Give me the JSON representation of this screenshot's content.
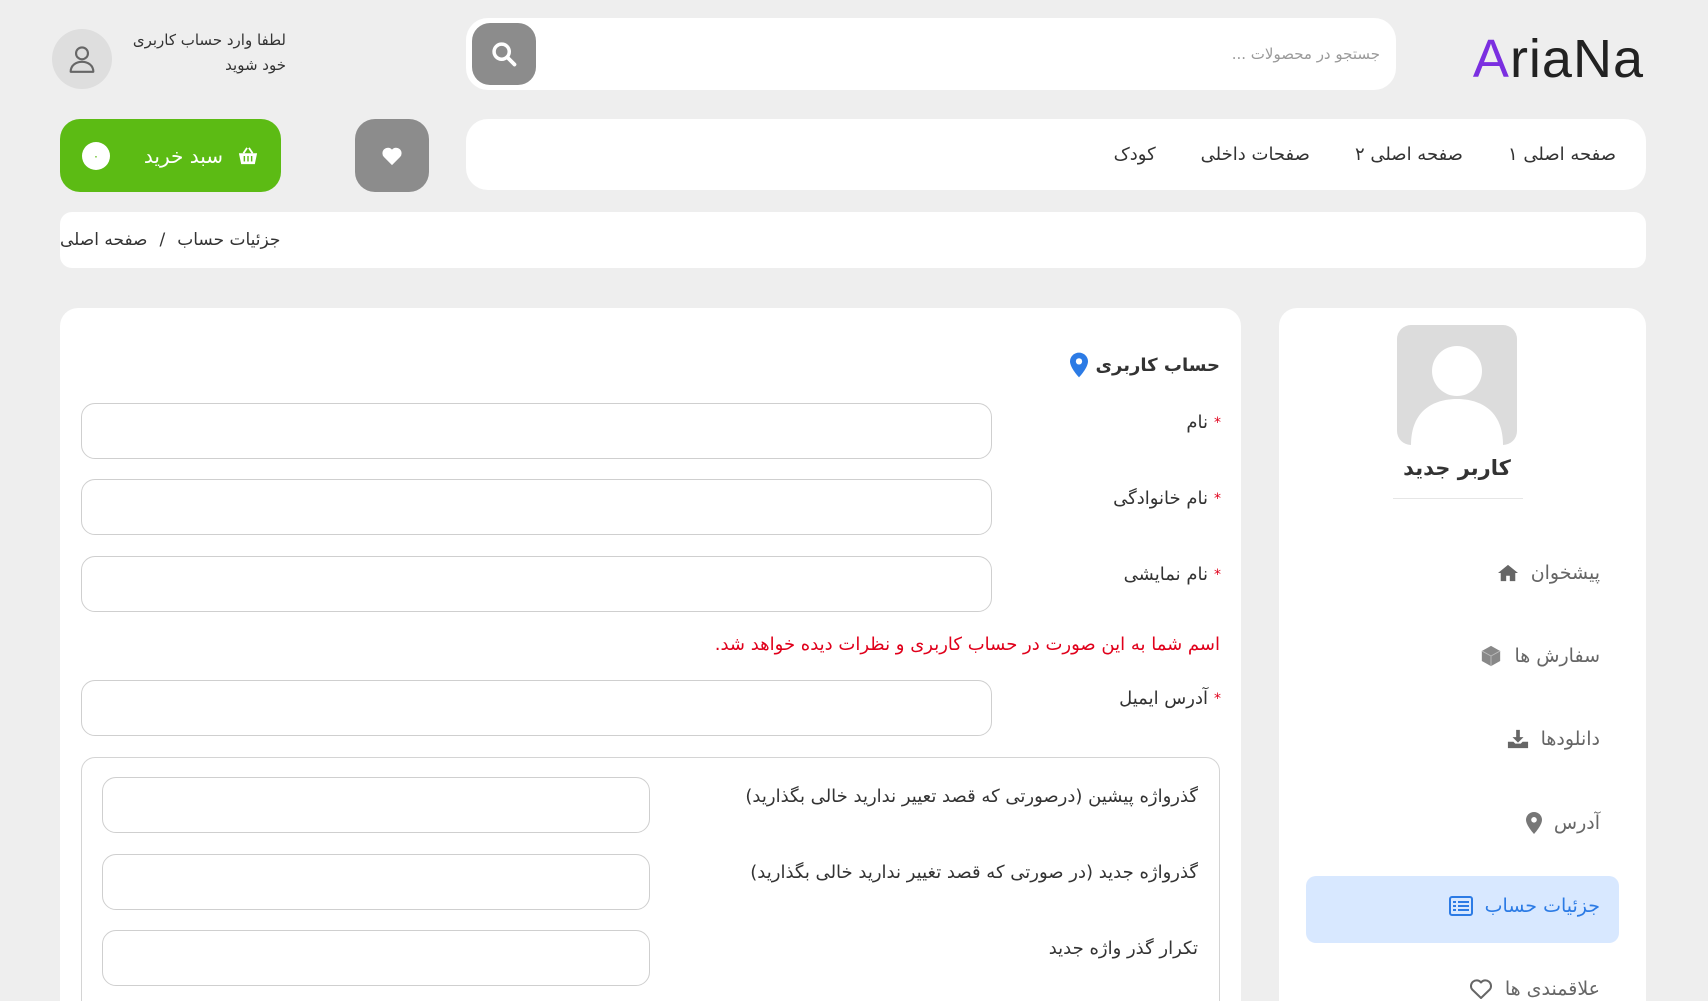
{
  "header": {
    "logo_first": "A",
    "logo_rest": "riaNa",
    "search": {
      "placeholder": "جستجو در محصولات ...",
      "icon": "search-icon"
    },
    "login_line1": "لطفا وارد حساب کاربری",
    "login_line2": "خود شوید"
  },
  "nav": {
    "items": [
      {
        "label": "صفحه اصلی ۱"
      },
      {
        "label": "صفحه اصلی ۲"
      },
      {
        "label": "صفحات داخلی"
      },
      {
        "label": "کودک"
      }
    ],
    "cart_label": "سبد خرید",
    "cart_count": "۰"
  },
  "breadcrumb": {
    "home": "صفحه اصلی",
    "separator": "/",
    "current": "جزئیات حساب"
  },
  "sidebar": {
    "user_name": "کاربر جدید",
    "items": [
      {
        "label": "پیشخوان",
        "icon": "home-icon"
      },
      {
        "label": "سفارش ها",
        "icon": "box-icon"
      },
      {
        "label": "دانلودها",
        "icon": "download-icon"
      },
      {
        "label": "آدرس",
        "icon": "map-pin-icon"
      },
      {
        "label": "جزئیات حساب",
        "icon": "list-icon",
        "active": true
      },
      {
        "label": "علاقمندی ها",
        "icon": "heart-icon"
      }
    ]
  },
  "form": {
    "section_title": "حساب کاربری",
    "first_name_label": "نام",
    "last_name_label": "نام خانوادگی",
    "display_name_label": "نام نمایشی",
    "display_name_hint": "اسم شما به این صورت در حساب کاربری و نظرات دیده خواهد شد.",
    "email_label": "آدرس ایمیل",
    "required_mark": "*",
    "current_password_label": "گذرواژه پیشین (درصورتی که قصد تعییر ندارید خالی بگذارید)",
    "new_password_label": "گذرواژه جدید (در صورتی که قصد تغییر ندارید خالی بگذارید)",
    "confirm_password_label": "تکرار گذر واژه جدید"
  },
  "colors": {
    "accent_green": "#5cbb14",
    "accent_purple": "#7b2fe0",
    "active_blue": "#2c7be5",
    "active_bg": "#d8e8ff",
    "required_red": "#e0001b"
  }
}
